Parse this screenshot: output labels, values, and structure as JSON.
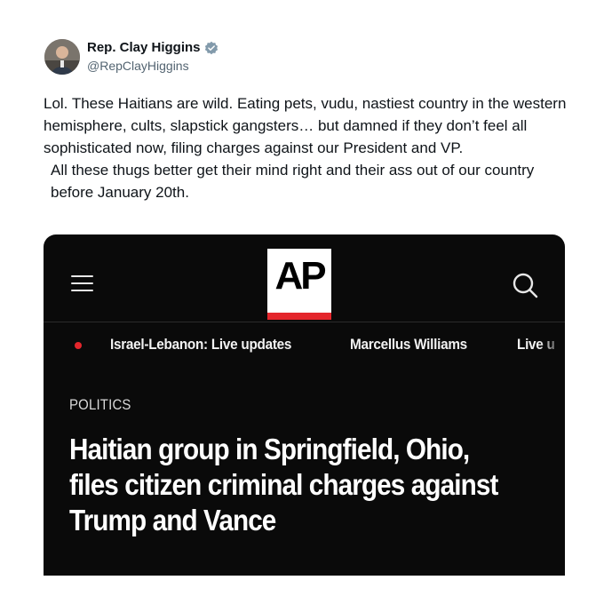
{
  "author": {
    "display_name": "Rep. Clay Higgins",
    "handle": "@RepClayHiggins",
    "verified_badge_color": "#829aab"
  },
  "tweet": {
    "paragraph_1": "Lol. These Haitians are wild. Eating pets, vudu, nastiest country in the western hemisphere, cults, slapstick gangsters… but damned if they don’t feel all sophisticated now, filing charges against our President and VP.",
    "paragraph_2": "All these thugs better get their mind right and their ass out of our country before January 20th."
  },
  "media": {
    "logo_text": "AP",
    "logo_accent_color": "#e4262c",
    "nav_items": [
      "Israel-Lebanon: Live updates",
      "Marcellus Williams",
      "Live u"
    ],
    "section": "POLITICS",
    "headline_lines": [
      "Haitian group in Springfield, Ohio,",
      "files citizen criminal charges against",
      "Trump and Vance"
    ]
  }
}
